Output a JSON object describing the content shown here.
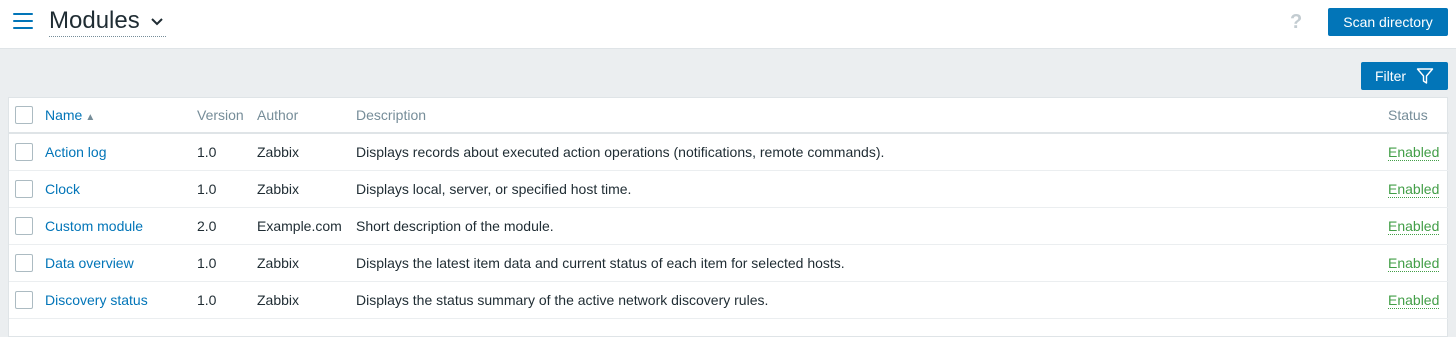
{
  "header": {
    "title": "Modules",
    "help_label": "?",
    "scan_button_label": "Scan directory"
  },
  "filter": {
    "label": "Filter"
  },
  "table": {
    "columns": {
      "name": "Name",
      "version": "Version",
      "author": "Author",
      "description": "Description",
      "status": "Status"
    },
    "sort_indicator": "▲",
    "rows": [
      {
        "name": "Action log",
        "version": "1.0",
        "author": "Zabbix",
        "description": "Displays records about executed action operations (notifications, remote commands).",
        "status": "Enabled"
      },
      {
        "name": "Clock",
        "version": "1.0",
        "author": "Zabbix",
        "description": "Displays local, server, or specified host time.",
        "status": "Enabled"
      },
      {
        "name": "Custom module",
        "version": "2.0",
        "author": "Example.com",
        "description": "Short description of the module.",
        "status": "Enabled"
      },
      {
        "name": "Data overview",
        "version": "1.0",
        "author": "Zabbix",
        "description": "Displays the latest item data and current status of each item for selected hosts.",
        "status": "Enabled"
      },
      {
        "name": "Discovery status",
        "version": "1.0",
        "author": "Zabbix",
        "description": "Displays the status summary of the active network discovery rules.",
        "status": "Enabled"
      }
    ]
  },
  "colors": {
    "accent": "#0275b8",
    "enabled": "#429e47",
    "background": "#ebeef0"
  },
  "icons": [
    "menu-icon",
    "chevron-down-icon",
    "help-icon",
    "filter-icon"
  ]
}
